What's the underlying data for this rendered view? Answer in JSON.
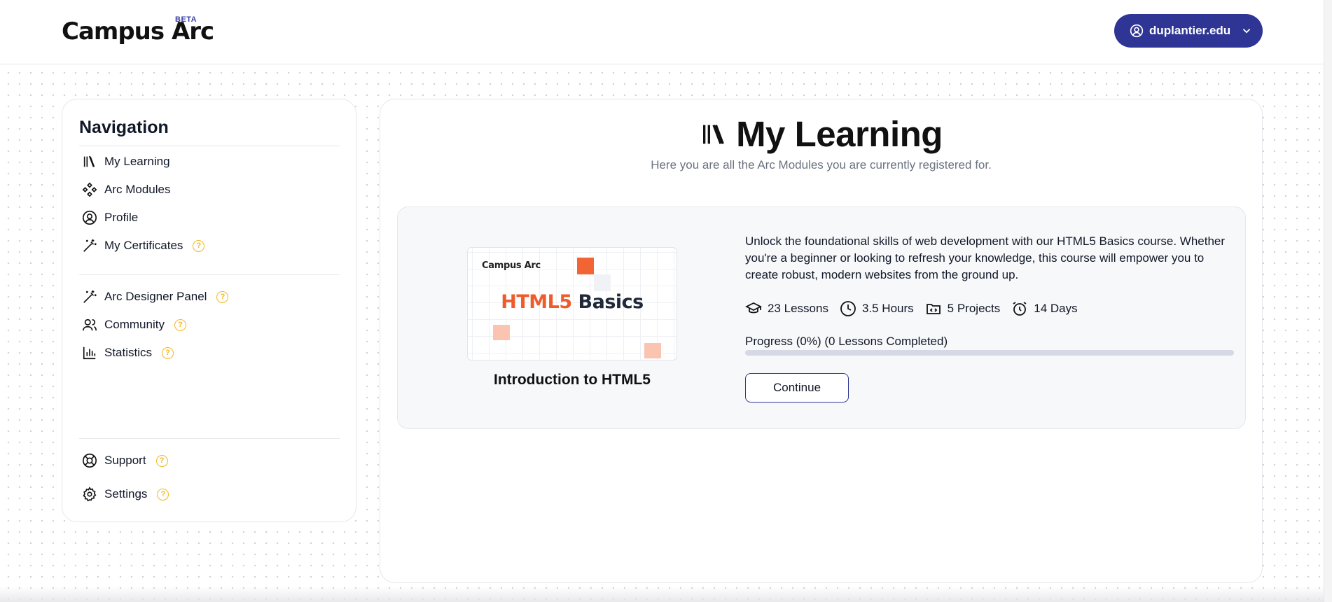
{
  "header": {
    "logo_text": "Campus Arc",
    "logo_badge": "BETA",
    "account_label": "duplantier.edu"
  },
  "sidebar": {
    "title": "Navigation",
    "primary_items": [
      {
        "label": "My Learning",
        "icon": "library-icon",
        "help": false
      },
      {
        "label": "Arc Modules",
        "icon": "modules-icon",
        "help": false
      },
      {
        "label": "Profile",
        "icon": "user-circle-icon",
        "help": false
      },
      {
        "label": "My Certificates",
        "icon": "magic-wand-icon",
        "help": true
      }
    ],
    "secondary_items": [
      {
        "label": "Arc Designer Panel",
        "icon": "magic-wand-icon",
        "help": true
      },
      {
        "label": "Community",
        "icon": "users-icon",
        "help": true
      },
      {
        "label": "Statistics",
        "icon": "bar-chart-icon",
        "help": true
      }
    ],
    "footer_items": [
      {
        "label": "Support",
        "icon": "lifebuoy-icon",
        "help": true
      },
      {
        "label": "Settings",
        "icon": "gear-icon",
        "help": true
      }
    ],
    "help_glyph": "?"
  },
  "main": {
    "title": "My Learning",
    "subtitle": "Here you are all the Arc Modules you are currently registered for.",
    "course": {
      "thumbnail_logo": "Campus Arc",
      "thumbnail_title_accent": "HTML5",
      "thumbnail_title_rest": "Basics",
      "name": "Introduction to HTML5",
      "description": "Unlock the foundational skills of web development with our HTML5 Basics course. Whether you're a beginner or looking to refresh your knowledge, this course will empower you to create robust, modern websites from the ground up.",
      "stats": {
        "lessons": "23 Lessons",
        "hours": "3.5 Hours",
        "projects": "5 Projects",
        "days": "14 Days"
      },
      "progress_label": "Progress (0%) (0 Lessons Completed)",
      "progress_percent": 0,
      "continue_label": "Continue"
    }
  },
  "colors": {
    "brand": "#2f3594",
    "help_accent": "#f2b824",
    "thumbnail_accent": "#ef5b2b"
  }
}
